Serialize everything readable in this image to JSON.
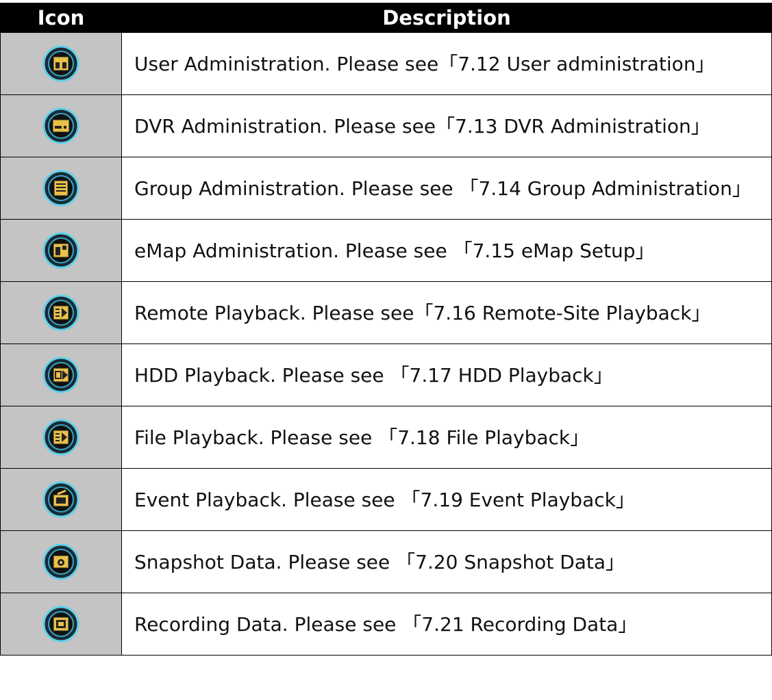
{
  "table": {
    "headers": {
      "icon": "Icon",
      "description": "Description"
    },
    "rows": [
      {
        "icon": "user-admin-icon",
        "description": "User Administration. Please see「7.12 User administration」"
      },
      {
        "icon": "dvr-admin-icon",
        "description": "DVR Administration. Please see「7.13 DVR Administration」"
      },
      {
        "icon": "group-admin-icon",
        "description": "Group Administration. Please see 「7.14 Group Administration」"
      },
      {
        "icon": "emap-admin-icon",
        "description": "eMap Administration. Please see 「7.15 eMap Setup」"
      },
      {
        "icon": "remote-playback-icon",
        "description": "Remote Playback. Please see「7.16 Remote-Site Playback」"
      },
      {
        "icon": "hdd-playback-icon",
        "description": "HDD Playback. Please see 「7.17 HDD Playback」"
      },
      {
        "icon": "file-playback-icon",
        "description": "File Playback. Please see 「7.18 File Playback」"
      },
      {
        "icon": "event-playback-icon",
        "description": "Event Playback. Please see 「7.19 Event Playback」"
      },
      {
        "icon": "snapshot-data-icon",
        "description": "Snapshot Data. Please see 「7.20 Snapshot Data」"
      },
      {
        "icon": "recording-data-icon",
        "description": "Recording Data. Please see 「7.21 Recording Data」"
      }
    ]
  }
}
